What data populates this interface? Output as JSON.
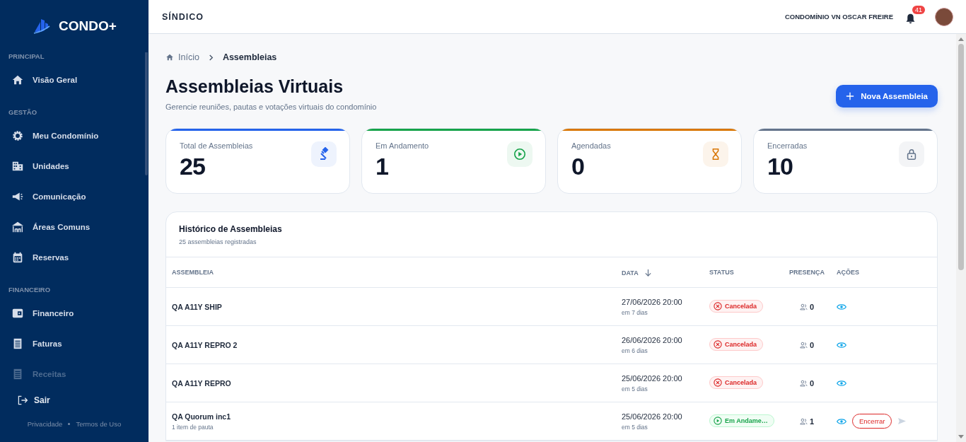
{
  "sidebar": {
    "brand": "CONDO+",
    "sections": [
      {
        "title": "PRINCIPAL",
        "items": [
          {
            "label": "Visão Geral",
            "selected": false,
            "faded": false
          }
        ]
      },
      {
        "title": "GESTÃO",
        "items": [
          {
            "label": "Meu Condomínio",
            "selected": false,
            "faded": false
          },
          {
            "label": "Unidades",
            "selected": false,
            "faded": false
          },
          {
            "label": "Comunicação",
            "selected": false,
            "faded": false
          },
          {
            "label": "Áreas Comuns",
            "selected": false,
            "faded": false
          },
          {
            "label": "Reservas",
            "selected": false,
            "faded": false
          }
        ]
      },
      {
        "title": "FINANCEIRO",
        "items": [
          {
            "label": "Financeiro",
            "selected": false,
            "faded": false
          },
          {
            "label": "Faturas",
            "selected": false,
            "faded": false
          },
          {
            "label": "Receitas",
            "selected": false,
            "faded": true
          }
        ]
      }
    ],
    "logout": "Sair",
    "footer_links": [
      "Privacidade",
      "Termos de Uso"
    ]
  },
  "header": {
    "role": "SÍNDICO",
    "condo": "CONDOMÍNIO VN OSCAR FREIRE",
    "notifications": "41"
  },
  "breadcrumb": [
    "Início",
    "Assembleias"
  ],
  "page": {
    "title": "Assembleias Virtuais",
    "subtitle": "Gerencie reuniões, pautas e votações virtuais do condomínio",
    "button": "Nova Assembleia"
  },
  "stats": [
    {
      "label": "Total de Assembleias",
      "value": "25",
      "color": "#2563eb"
    },
    {
      "label": "Em Andamento",
      "value": "1",
      "color": "#16a34a"
    },
    {
      "label": "Agendadas",
      "value": "0",
      "color": "#d97706"
    },
    {
      "label": "Encerradas",
      "value": "10",
      "color": "#64748b"
    }
  ],
  "table": {
    "title": "Histórico de Assembleias",
    "subtitle": "25 assembleias registradas",
    "columns": [
      "ASSEMBLEIA",
      "DATA",
      "STATUS",
      "PRESENÇA",
      "AÇÕES"
    ],
    "rows": [
      {
        "name": "QA A11Y SHIP",
        "date": "27/06/2026 20:00",
        "relative": "em 7 dias",
        "status": {
          "kind": "cancelled",
          "label": "Cancelada"
        },
        "presence": "0"
      },
      {
        "name": "QA A11Y REPRO 2",
        "date": "26/06/2026 20:00",
        "relative": "em 6 dias",
        "status": {
          "kind": "cancelled",
          "label": "Cancelada"
        },
        "presence": "0"
      },
      {
        "name": "QA A11Y REPRO",
        "date": "25/06/2026 20:00",
        "relative": "em 5 dias",
        "status": {
          "kind": "cancelled",
          "label": "Cancelada"
        },
        "presence": "0"
      },
      {
        "name": "QA Quorum inc1",
        "note": "1 item de pauta",
        "date": "25/06/2026 20:00",
        "relative": "em 5 dias",
        "status": {
          "kind": "running",
          "label": "Em Andame…"
        },
        "presence": "1",
        "close_button": "Encerrar",
        "send_disabled": true
      }
    ]
  }
}
